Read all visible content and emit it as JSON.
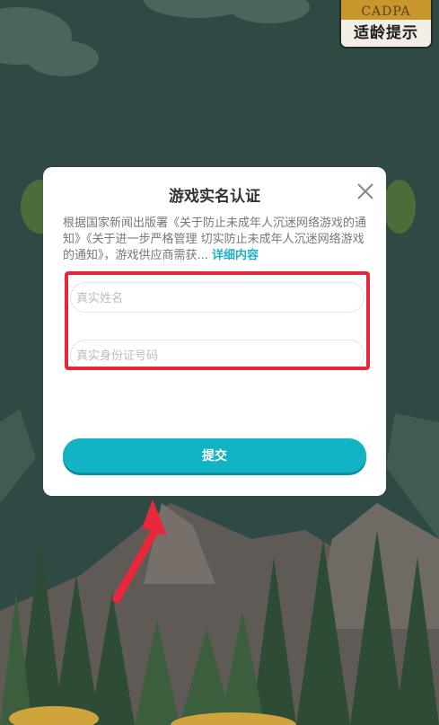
{
  "badge": {
    "top_text": "CADPA",
    "bottom_text": "适龄提示"
  },
  "dialog": {
    "title": "游戏实名认证",
    "close_icon": "close-icon",
    "notice_text": "根据国家新闻出版署《关于防止未成年人沉迷网络游戏的通知》《关于进一步严格管理 切实防止未成年人沉迷网络游戏的通知》，游戏供应商需获...",
    "more_link": "详细内容",
    "name_field": {
      "placeholder": "真实姓名",
      "value": ""
    },
    "id_field": {
      "placeholder": "真实身份证号码",
      "value": ""
    },
    "submit_label": "提交"
  },
  "annotations": {
    "highlight_color": "#e8283a",
    "arrow_color": "#e8283a"
  },
  "colors": {
    "accent": "#12b3c4",
    "badge_gold": "#c9962c",
    "background": "#2f4a45"
  }
}
